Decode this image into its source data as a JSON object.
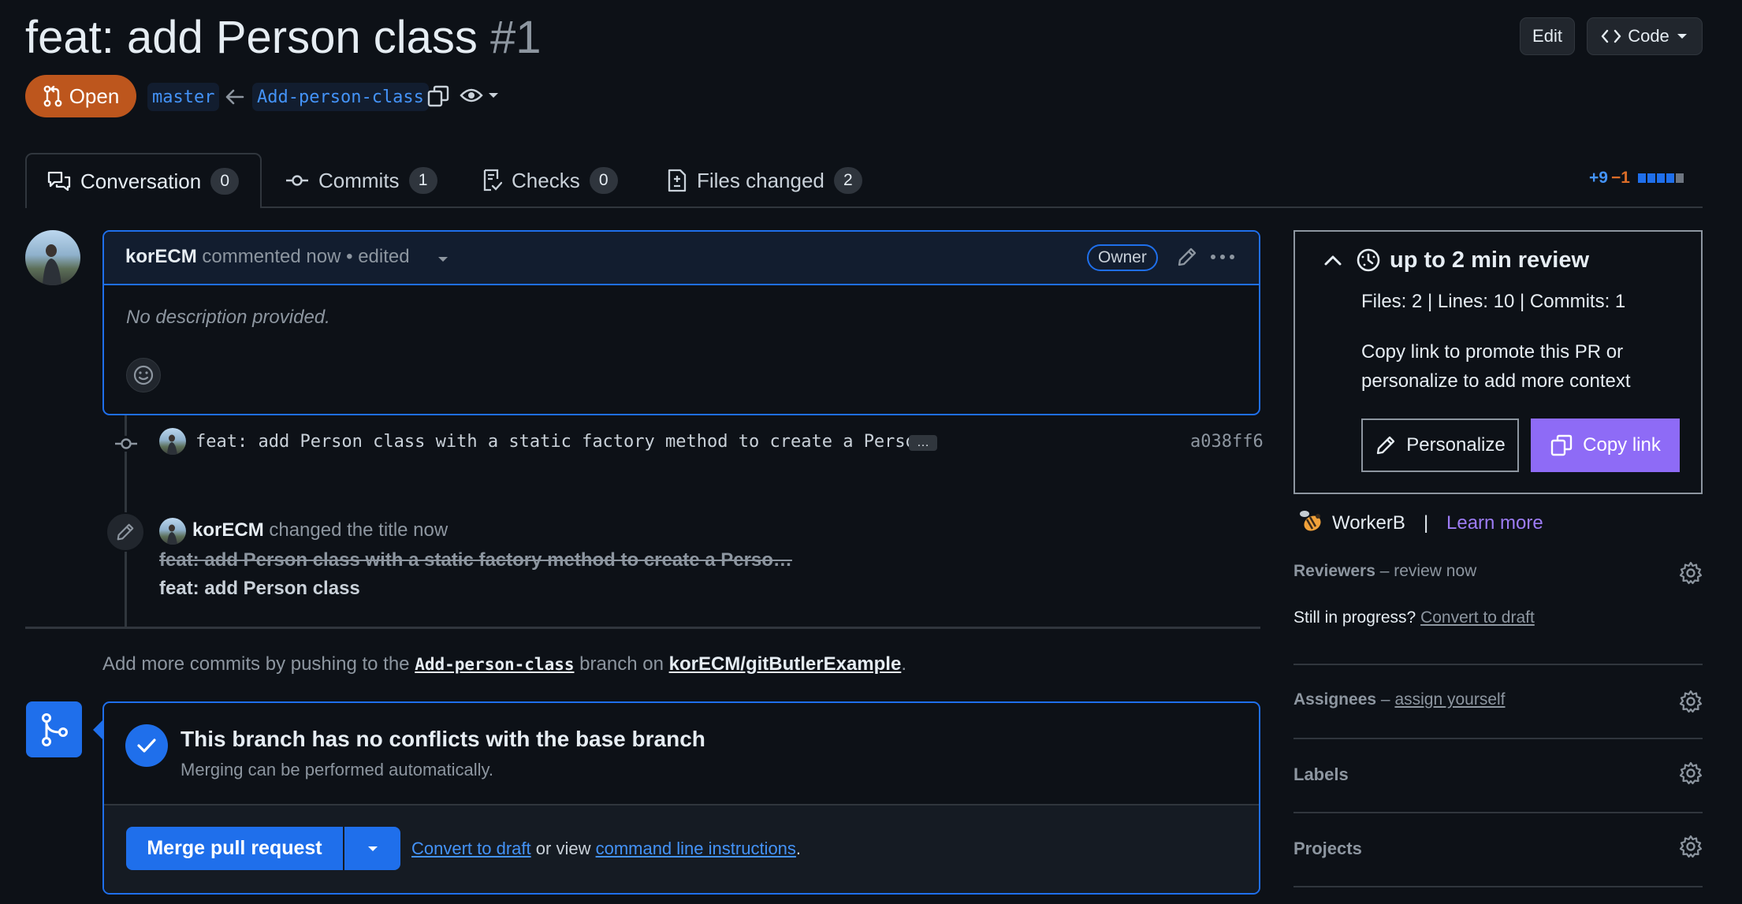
{
  "header": {
    "title": "feat: add Person class",
    "number": "#1",
    "edit_label": "Edit",
    "code_label": "Code",
    "state_label": "Open",
    "base_branch": "master",
    "head_branch": "Add-person-class"
  },
  "tabs": [
    {
      "label": "Conversation",
      "count": "0"
    },
    {
      "label": "Commits",
      "count": "1"
    },
    {
      "label": "Checks",
      "count": "0"
    },
    {
      "label": "Files changed",
      "count": "2"
    }
  ],
  "diffstat": {
    "additions": "+9",
    "deletions": "−1"
  },
  "comment": {
    "author": "korECM",
    "action": "commented now",
    "edited": "• edited",
    "badge": "Owner",
    "body": "No description provided."
  },
  "timeline": {
    "commit_message": "feat: add Person class with a static factory method to create a Perso…",
    "commit_more": "…",
    "commit_sha": "a038ff6",
    "rename_author": "korECM",
    "rename_action": "changed the title now",
    "old_title": "feat: add Person class with a static factory method to create a Perso…",
    "new_title": "feat: add Person class"
  },
  "push_hint": {
    "prefix": "Add more commits by pushing to the",
    "branch": "Add-person-class",
    "middle": "branch on",
    "repo": "korECM/gitButlerExample",
    "suffix": "."
  },
  "merge": {
    "title": "This branch has no conflicts with the base branch",
    "subtitle": "Merging can be performed automatically.",
    "button": "Merge pull request",
    "convert": "Convert to draft",
    "or_view": "or view",
    "cli": "command line instructions",
    "period": "."
  },
  "review_card": {
    "title": "up to 2 min review",
    "stats": "Files: 2 | Lines: 10 | Commits: 1",
    "desc_line1": "Copy link to promote this PR or",
    "desc_line2": "personalize to add more context",
    "personalize": "Personalize",
    "copy": "Copy link",
    "brand": "WorkerB",
    "sep": "|",
    "learn": "Learn more"
  },
  "sidebar": {
    "reviewers_label": "Reviewers",
    "reviewers_value": "– review now",
    "progress_q": "Still in progress?",
    "progress_link": "Convert to draft",
    "assignees_label": "Assignees",
    "assignees_dash": "–",
    "assignees_link": "assign yourself",
    "labels_label": "Labels",
    "projects_label": "Projects"
  },
  "colors": {
    "background": "#0d1117",
    "accent": "#1f6feb",
    "open_state": "#bd561d",
    "link": "#4493f8",
    "copy_button": "#8e6bf6"
  }
}
